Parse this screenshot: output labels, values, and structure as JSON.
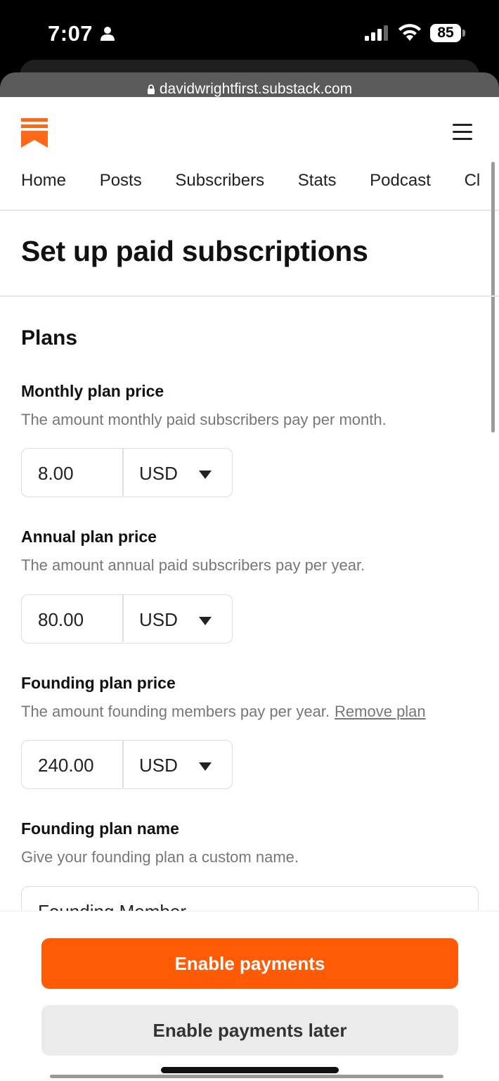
{
  "status_bar": {
    "time": "7:07",
    "battery": "85"
  },
  "browser": {
    "url": "davidwrightfirst.substack.com"
  },
  "nav": {
    "items": [
      "Home",
      "Posts",
      "Subscribers",
      "Stats",
      "Podcast",
      "Cl"
    ]
  },
  "page": {
    "title": "Set up paid subscriptions"
  },
  "plans": {
    "heading": "Plans",
    "monthly": {
      "label": "Monthly plan price",
      "description": "The amount monthly paid subscribers pay per month.",
      "value": "8.00",
      "currency": "USD"
    },
    "annual": {
      "label": "Annual plan price",
      "description": "The amount annual paid subscribers pay per year.",
      "value": "80.00",
      "currency": "USD"
    },
    "founding": {
      "label": "Founding plan price",
      "description": "The amount founding members pay per year.",
      "remove_link": "Remove plan",
      "value": "240.00",
      "currency": "USD"
    },
    "founding_name": {
      "label": "Founding plan name",
      "description": "Give your founding plan a custom name.",
      "value": "Founding Member"
    }
  },
  "footer": {
    "primary": "Enable payments",
    "secondary": "Enable payments later"
  },
  "colors": {
    "accent": "#ff5a06"
  }
}
